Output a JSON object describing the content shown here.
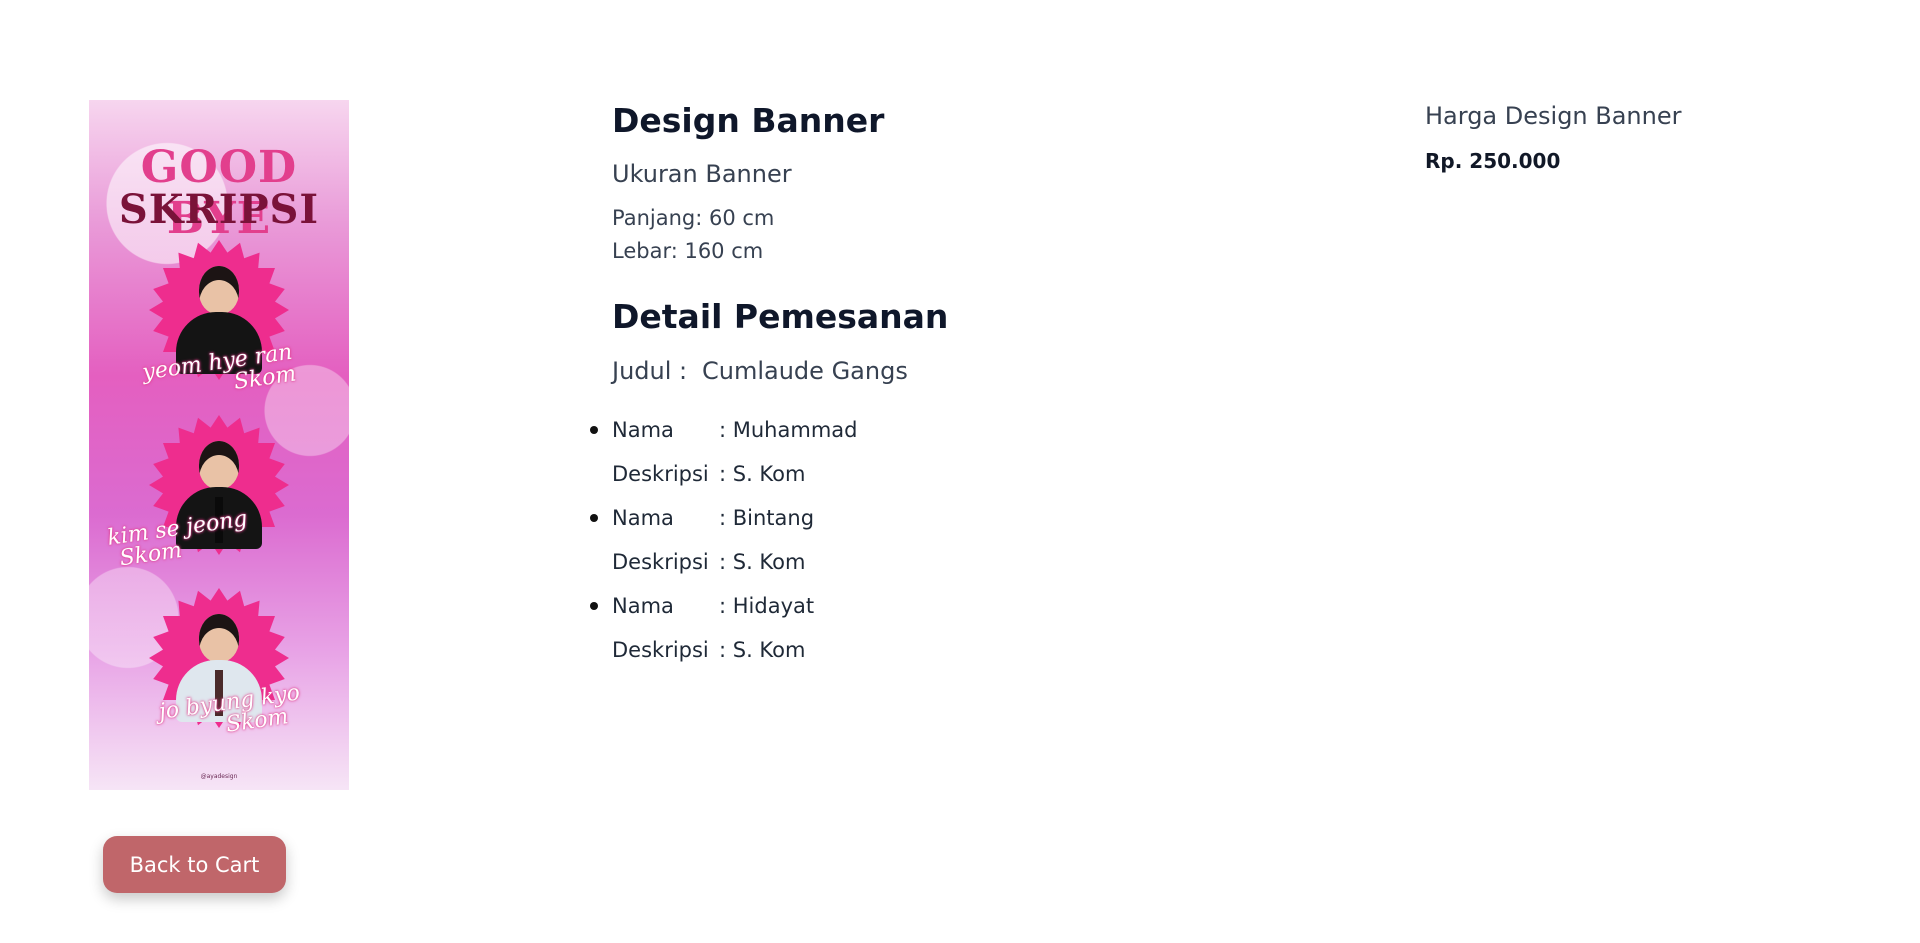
{
  "banner": {
    "title_line1": "GOOD BYE",
    "title_line2": "SKRIPSI",
    "names": [
      {
        "line1": "yeom hye ran",
        "line2": "Skom"
      },
      {
        "line1": "kim se jeong",
        "line2": "Skom"
      },
      {
        "line1": "jo byung kyo",
        "line2": "Skom"
      }
    ],
    "credit": "@ayadesign"
  },
  "product": {
    "title": "Design Banner",
    "size_heading": "Ukuran Banner",
    "length": "Panjang: 60 cm",
    "width": "Lebar: 160 cm"
  },
  "order": {
    "heading": "Detail Pemesanan",
    "title_label": "Judul :",
    "title_value": "Cumlaude Gangs",
    "name_label": "Nama",
    "desc_label": "Deskripsi",
    "members": [
      {
        "name": ": Muhammad",
        "description": ": S. Kom"
      },
      {
        "name": ": Bintang",
        "description": ": S. Kom"
      },
      {
        "name": ": Hidayat",
        "description": ": S. Kom"
      }
    ]
  },
  "pricing": {
    "label": "Harga Design Banner",
    "value": "Rp. 250.000"
  },
  "actions": {
    "back_label": "Back to Cart"
  },
  "colors": {
    "button": "#c0666a",
    "heading": "#0f172a",
    "banner_pink": "#e23f8d"
  }
}
